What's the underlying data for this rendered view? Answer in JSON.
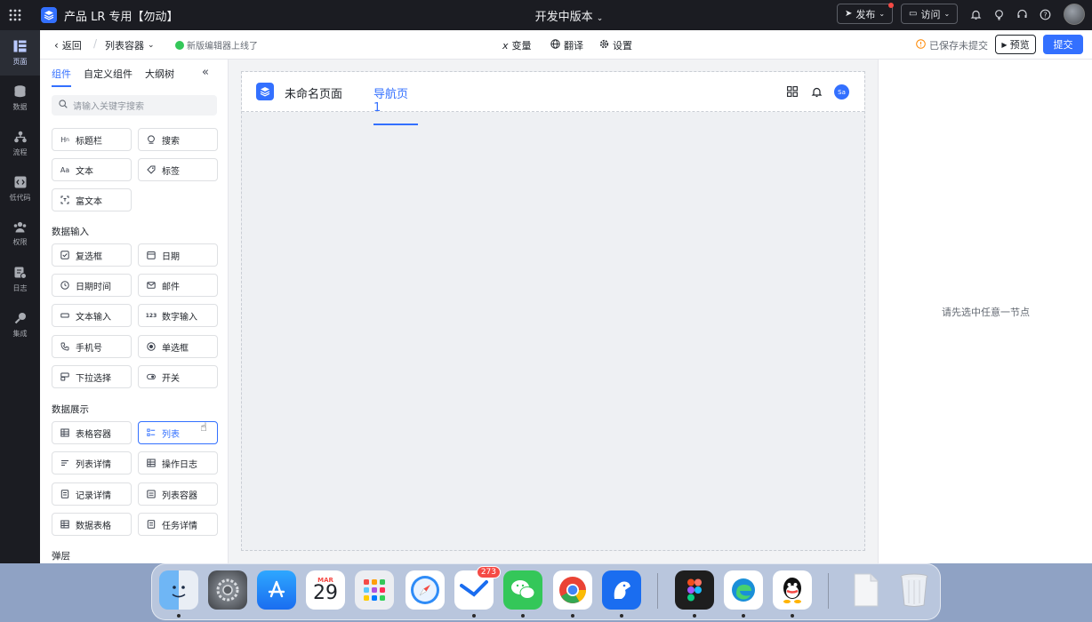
{
  "topbar": {
    "app_title": "产品 LR 专用【勿动】",
    "version": "开发中版本",
    "publish_label": "发布",
    "visit_label": "访问"
  },
  "rail": {
    "items": [
      {
        "label": "页面",
        "icon": "page-icon"
      },
      {
        "label": "数据",
        "icon": "database-icon"
      },
      {
        "label": "流程",
        "icon": "flow-icon"
      },
      {
        "label": "低代码",
        "icon": "code-icon"
      },
      {
        "label": "权限",
        "icon": "users-icon"
      },
      {
        "label": "日志",
        "icon": "log-icon"
      },
      {
        "label": "集成",
        "icon": "integration-icon"
      }
    ]
  },
  "toolbar": {
    "back": "返回",
    "crumb": "列表容器",
    "notice": "新版编辑器上线了",
    "variable": "变量",
    "translate": "翻译",
    "settings": "设置",
    "saved": "已保存未提交",
    "preview": "预览",
    "submit": "提交"
  },
  "panel": {
    "tabs": [
      "组件",
      "自定义组件",
      "大纲树"
    ],
    "search_placeholder": "请输入关键字搜索",
    "section_data_input": "数据输入",
    "section_data_display": "数据展示",
    "section_popup": "弹层",
    "basic": [
      {
        "label": "标题栏",
        "icon": "heading-icon"
      },
      {
        "label": "搜索",
        "icon": "search-icon"
      },
      {
        "label": "文本",
        "icon": "text-icon"
      },
      {
        "label": "标签",
        "icon": "tag-icon"
      },
      {
        "label": "富文本",
        "icon": "rich-text-icon"
      }
    ],
    "input": [
      {
        "label": "复选框",
        "icon": "checkbox-icon"
      },
      {
        "label": "日期",
        "icon": "date-icon"
      },
      {
        "label": "日期时间",
        "icon": "clock-icon"
      },
      {
        "label": "邮件",
        "icon": "mail-icon"
      },
      {
        "label": "文本输入",
        "icon": "text-input-icon"
      },
      {
        "label": "数字输入",
        "icon": "number-icon"
      },
      {
        "label": "手机号",
        "icon": "phone-icon"
      },
      {
        "label": "单选框",
        "icon": "radio-icon"
      },
      {
        "label": "下拉选择",
        "icon": "select-icon"
      },
      {
        "label": "开关",
        "icon": "switch-icon"
      }
    ],
    "display": [
      {
        "label": "表格容器",
        "icon": "table-icon"
      },
      {
        "label": "列表",
        "icon": "list-icon"
      },
      {
        "label": "列表详情",
        "icon": "list-detail-icon"
      },
      {
        "label": "操作日志",
        "icon": "oplog-icon"
      },
      {
        "label": "记录详情",
        "icon": "record-icon"
      },
      {
        "label": "列表容器",
        "icon": "list-container-icon"
      },
      {
        "label": "数据表格",
        "icon": "data-table-icon"
      },
      {
        "label": "任务详情",
        "icon": "task-icon"
      }
    ]
  },
  "canvas": {
    "page_title": "未命名页面",
    "nav_tab": "导航页 1",
    "avatar": "Sa"
  },
  "props": {
    "empty": "请先选中任意一节点"
  },
  "dock": {
    "calendar_month": "MAR",
    "calendar_day": "29",
    "mail_badge": "273"
  }
}
